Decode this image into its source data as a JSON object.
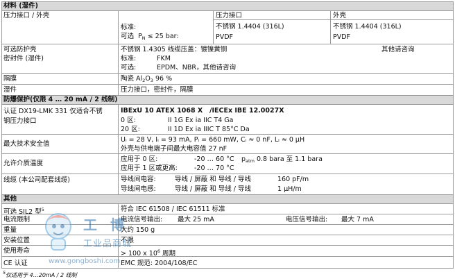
{
  "materials": {
    "header": "材料 (湿件)",
    "pressure_housing": {
      "label": "压力接口 / 外壳",
      "col_pressure": "压力接口",
      "col_housing": "外壳",
      "std_label": "标准:",
      "std_pressure": "不锈钢 1.4404 (316L)",
      "std_housing": "不锈钢 1.4404 (316L)",
      "opt_label": "可选",
      "opt_symbol": "P",
      "opt_sub": "N",
      "opt_cond": "≤ 25 bar:",
      "opt_pressure": "PVDF",
      "opt_housing": "PVDF"
    },
    "guard": {
      "label": "可选防护壳",
      "value": "不锈钢 1.4305 线缆压盖：镀镍黄铜",
      "note": "其他请咨询"
    },
    "seal": {
      "label": "密封件 (湿件)",
      "std_label": "标准:",
      "std_value": "FKM",
      "opt_label": "可选:",
      "opt_value": "EPDM、NBR，其他请咨询"
    },
    "diaphragm": {
      "label": "隔膜",
      "value_pre": "陶瓷 Al",
      "value_sub1": "2",
      "value_mid": "O",
      "value_sub2": "3",
      "value_post": " 96 %"
    },
    "wetted": {
      "label": "湿件",
      "value": "压力接口，密封件，隔膜"
    }
  },
  "explosion": {
    "header": "防爆保护(仅限 4 … 20 mA / 2 线制)",
    "cert": {
      "label1": "认证 DX19-LMK 331 仅适合不锈",
      "label2": "钢压力接口",
      "title_a": "IBExU 10 ATEX 1068 X",
      "title_b": "/IECEx IBE 12.0027X",
      "zone0_label": "0 区:",
      "zone0_value": "II 1G Ex ia IIC T4 Ga",
      "zone20_label": "20 区:",
      "zone20_value": "II 1D Ex ia IIIC T 85°C Da"
    },
    "safety": {
      "label": "最大技术安全值",
      "line1": "Uᵢ = 28 V, Iᵢ = 93 mA, Pᵢ = 660 mW, Cᵢ ≈ 0 nF, Lᵢ ≈ 0 μH",
      "line2": "外壳与供电端子间最大电容值 27 nF"
    },
    "temp": {
      "label": "允许介质温度",
      "row1_label": "应用于 0 区:",
      "row1_value": "-20 … 60 °C",
      "row1_cond_p": "p",
      "row1_cond_sub": "atm",
      "row1_cond": "0.8 bara 至 1.1 bara",
      "row2_label": "应用于 1 区或更高:",
      "row2_value": "-20 … 70 °C"
    },
    "cable": {
      "label": "线缆 (本公司配套线缆)",
      "cap_label": "导线间电容:",
      "cap_text": "导线 / 屏蔽 和 导线 / 导线",
      "cap_value": "160 pF/m",
      "ind_label": "导线间电感:",
      "ind_text": "导线 / 屏蔽 和 导线 / 导线",
      "ind_value": "1 μH/m"
    }
  },
  "misc": {
    "header": "其他",
    "sil": {
      "label": "可选 SIL2 型",
      "sup": "5",
      "value": "符合 IEC 61508 / IEC 61511 标准"
    },
    "current": {
      "label": "电流限制",
      "a_label": "电流信号输出:",
      "a_value": "最大 25 mA",
      "b_label": "电压信号输出:",
      "b_value": "最大 7 mA"
    },
    "weight": {
      "label": "重量",
      "value": "大约 150 g"
    },
    "position": {
      "label": "安装位置",
      "value": "不限"
    },
    "life": {
      "label": "使用寿命",
      "value_pre": "> 100 x 10",
      "value_sup": "6",
      "value_post": " 周期"
    },
    "ce": {
      "label": "CE 认证",
      "value": "EMC 规范:  2004/108/EC"
    }
  },
  "footnote": {
    "sup": "5",
    "text": "仅适用于 4…20mA / 2 线制"
  },
  "watermark": {
    "cn_top": "工 博",
    "cn_bottom": "工业品商城",
    "url": "www.gongboshi.com"
  },
  "colors": {
    "header_bg": "#d9d9d9",
    "grid": "#9a9a9a",
    "watermark": "#2f7fc1"
  }
}
